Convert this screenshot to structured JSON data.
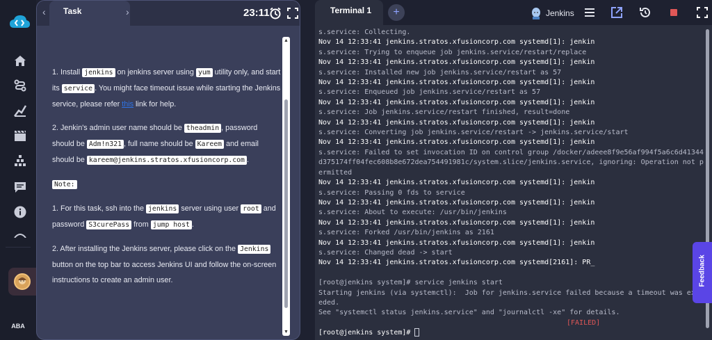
{
  "rail": {
    "items": [
      {
        "icon": "home-icon"
      },
      {
        "icon": "route-icon"
      },
      {
        "icon": "graph-icon"
      },
      {
        "icon": "clapperboard-icon"
      },
      {
        "icon": "pyramid-icon"
      },
      {
        "icon": "chat-icon"
      },
      {
        "icon": "info-icon"
      },
      {
        "icon": "theme-toggle-icon"
      }
    ],
    "user_initials": "ABA"
  },
  "task_panel": {
    "tab_label": "Task",
    "timer": "23:11",
    "step1": {
      "t1": "1. Install ",
      "c1": "jenkins",
      "t2": " on jenkins server using ",
      "c2": "yum",
      "t3": " utility only, and start its ",
      "c3": "service",
      "t4": ". You might face timeout issue while starting the Jenkins service, please refer ",
      "link": "this",
      "t5": " link for help."
    },
    "step2": {
      "t1": "2. Jenkin's admin user name should be ",
      "c1": "theadmin",
      "t2": ", password should be ",
      "c2": "Adm!n321",
      "t3": ", full name should be ",
      "c3": "Kareem",
      "t4": " and email should be ",
      "c4": "kareem@jenkins.stratos.xfusioncorp.com",
      "t5": "."
    },
    "note_label": "Note:",
    "note1": {
      "t1": "1. For this task, ssh into the ",
      "c1": "jenkins",
      "t2": " server using user ",
      "c2": "root",
      "t3": " and password ",
      "c3": "S3curePass",
      "t4": " from ",
      "c4": "jump host",
      "t5": "."
    },
    "note2": {
      "t1": "2. After installing the Jenkins server, please click on the ",
      "c1": "Jenkins",
      "t2": " button on the top bar to access Jenkins UI and follow the on-screen instructions to create an admin user."
    }
  },
  "terminal": {
    "tab_label": "Terminal 1",
    "jenkins_button": "Jenkins",
    "lines": [
      {
        "text": "s.service: Collecting.",
        "style": "dim"
      },
      {
        "text": "Nov 14 12:33:41 jenkins.stratos.xfusioncorp.com systemd[1]: jenkin",
        "style": "host"
      },
      {
        "text": "s.service: Trying to enqueue job jenkins.service/restart/replace",
        "style": "dim"
      },
      {
        "text": "Nov 14 12:33:41 jenkins.stratos.xfusioncorp.com systemd[1]: jenkin",
        "style": "host"
      },
      {
        "text": "s.service: Installed new job jenkins.service/restart as 57",
        "style": "dim"
      },
      {
        "text": "Nov 14 12:33:41 jenkins.stratos.xfusioncorp.com systemd[1]: jenkin",
        "style": "host"
      },
      {
        "text": "s.service: Enqueued job jenkins.service/restart as 57",
        "style": "dim"
      },
      {
        "text": "Nov 14 12:33:41 jenkins.stratos.xfusioncorp.com systemd[1]: jenkin",
        "style": "host"
      },
      {
        "text": "s.service: Job jenkins.service/restart finished, result=done",
        "style": "dim"
      },
      {
        "text": "Nov 14 12:33:41 jenkins.stratos.xfusioncorp.com systemd[1]: jenkin",
        "style": "host"
      },
      {
        "text": "s.service: Converting job jenkins.service/restart -> jenkins.service/start",
        "style": "dim"
      },
      {
        "text": "Nov 14 12:33:41 jenkins.stratos.xfusioncorp.com systemd[1]: jenkin",
        "style": "host"
      },
      {
        "text": "s.service: Failed to set invocation ID on control group /docker/adeee8f9e56af994f5a6c6d41344d375174ff04fec608b8e672dea754491981c/system.slice/jenkins.service, ignoring: Operation not permitted",
        "style": "dim"
      },
      {
        "text": "Nov 14 12:33:41 jenkins.stratos.xfusioncorp.com systemd[1]: jenkin",
        "style": "host"
      },
      {
        "text": "s.service: Passing 0 fds to service",
        "style": "dim"
      },
      {
        "text": "Nov 14 12:33:41 jenkins.stratos.xfusioncorp.com systemd[1]: jenkin",
        "style": "host"
      },
      {
        "text": "s.service: About to execute: /usr/bin/jenkins",
        "style": "dim"
      },
      {
        "text": "Nov 14 12:33:41 jenkins.stratos.xfusioncorp.com systemd[1]: jenkin",
        "style": "host"
      },
      {
        "text": "s.service: Forked /usr/bin/jenkins as 2161",
        "style": "dim"
      },
      {
        "text": "Nov 14 12:33:41 jenkins.stratos.xfusioncorp.com systemd[1]: jenkin",
        "style": "host"
      },
      {
        "text": "s.service: Changed dead -> start",
        "style": "dim"
      },
      {
        "text": "Nov 14 12:33:41 jenkins.stratos.xfusioncorp.com systemd[2161]: PR_",
        "style": "host"
      },
      {
        "text": " ",
        "style": "dim"
      },
      {
        "text": "[root@jenkins system]# service jenkins start",
        "style": "dim"
      },
      {
        "text": "Starting jenkins (via systemctl):  Job for jenkins.service failed because a timeout was exceeded.",
        "style": "dim"
      },
      {
        "text": "See \"systemctl status jenkins.service\" and \"journalctl -xe\" for details.",
        "style": "dim"
      }
    ],
    "failed_status": "[FAILED]",
    "prompt": "[root@jenkins system]# "
  },
  "feedback_label": "Feedback",
  "colors": {
    "accent": "#5a45e6",
    "failed": "#e05757",
    "link": "#2d73e6",
    "record": "#e05757"
  }
}
